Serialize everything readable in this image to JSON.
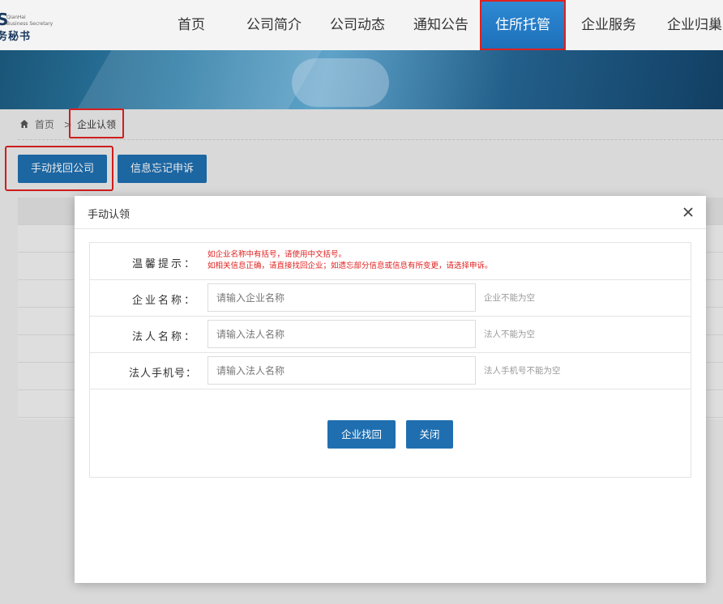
{
  "header": {
    "logo": {
      "mark": "S",
      "sub": "QianHai\nBusiness Secretary",
      "cn": "务秘书"
    },
    "nav": [
      {
        "label": "首页"
      },
      {
        "label": "公司简介"
      },
      {
        "label": "公司动态"
      },
      {
        "label": "通知公告"
      },
      {
        "label": "住所托管",
        "active": true
      },
      {
        "label": "企业服务"
      },
      {
        "label": "企业归巢"
      }
    ],
    "active_color": "#1f74bd",
    "highlight_color": "#e02020"
  },
  "breadcrumb": {
    "home": "首页",
    "separator": ">",
    "current": "企业认领",
    "home_icon": "home-icon"
  },
  "actions": {
    "find_company": "手动找回公司",
    "appeal": "信息忘记申诉"
  },
  "modal": {
    "title": "手动认领",
    "close_icon": "close-icon",
    "tip_label": "温馨提示：",
    "tip_lines": [
      "如企业名称中有括号，请使用中文括号。",
      "如相关信息正确，请直接找回企业；如遗忘部分信息或信息有所变更，请选择申诉。"
    ],
    "fields": [
      {
        "label": "企业名称：",
        "placeholder": "请输入企业名称",
        "value": "",
        "hint": "企业不能为空"
      },
      {
        "label": "法人名称：",
        "placeholder": "请输入法人名称",
        "value": "",
        "hint": "法人不能为空"
      },
      {
        "label": "法人手机号：",
        "placeholder": "请输入法人名称",
        "value": "",
        "hint": "法人手机号不能为空"
      }
    ],
    "submit_label": "企业找回",
    "close_label": "关闭"
  },
  "colors": {
    "primary_button": "#1f6fb0",
    "tip_text": "#e02020"
  }
}
